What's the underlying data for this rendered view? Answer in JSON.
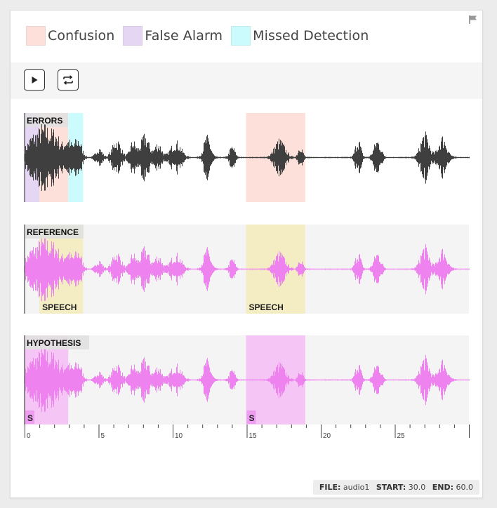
{
  "legend": {
    "items": [
      {
        "label": "Confusion",
        "color": "#fde0d9"
      },
      {
        "label": "False Alarm",
        "color": "#e5d6f3"
      },
      {
        "label": "Missed Detection",
        "color": "#cbfbfd"
      }
    ]
  },
  "toolbar": {
    "play_icon": "play-icon",
    "loop_icon": "loop-icon"
  },
  "tracks": {
    "errors": {
      "label": "ERRORS",
      "wave_color": "#3f3f3f",
      "regions": [
        {
          "type": "False Alarm",
          "start": 0.0,
          "end": 1.0
        },
        {
          "type": "Confusion",
          "start": 1.0,
          "end": 2.95
        },
        {
          "type": "Missed Detection",
          "start": 2.95,
          "end": 3.95
        },
        {
          "type": "Confusion",
          "start": 14.95,
          "end": 18.95
        }
      ]
    },
    "reference": {
      "label": "REFERENCE",
      "wave_color": "#ee82ee",
      "regions": [
        {
          "label": "SPEECH",
          "start": 1.0,
          "end": 3.95,
          "color": "#f4edc4"
        },
        {
          "label": "SPEECH",
          "start": 14.95,
          "end": 18.95,
          "color": "#f4edc4"
        }
      ]
    },
    "hypothesis": {
      "label": "HYPOTHESIS",
      "wave_color": "#ee82ee",
      "regions": [
        {
          "label": "S",
          "start": 0.0,
          "end": 2.95,
          "color": "#f5c6f5"
        },
        {
          "label": "S",
          "start": 14.95,
          "end": 18.95,
          "color": "#f5c6f5"
        }
      ]
    }
  },
  "timeline": {
    "min": 0,
    "max": 30,
    "ticks": [
      "0",
      "5",
      "10",
      "15",
      "20",
      "25"
    ]
  },
  "status": {
    "file_label": "FILE:",
    "file_value": "audio1",
    "start_label": "START:",
    "start_value": "30.0",
    "end_label": "END:",
    "end_value": "60.0"
  },
  "icons": {
    "flag": "flag-icon"
  }
}
